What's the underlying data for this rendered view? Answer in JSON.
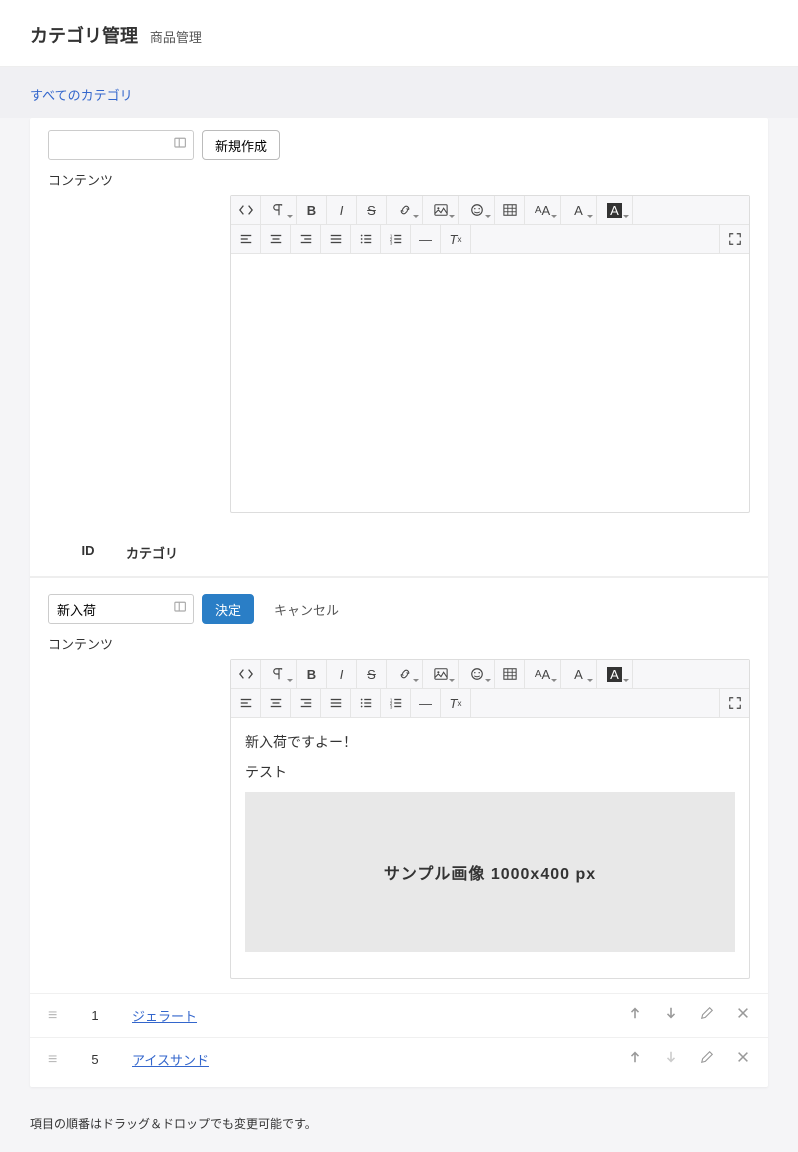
{
  "header": {
    "title": "カテゴリ管理",
    "subtitle": "商品管理"
  },
  "breadcrumb": {
    "all": "すべてのカテゴリ"
  },
  "form": {
    "create_button": "新規作成",
    "content_label": "コンテンツ",
    "confirm_button": "決定",
    "cancel_button": "キャンセル",
    "edit_input_value": "新入荷"
  },
  "table": {
    "col_id": "ID",
    "col_category": "カテゴリ"
  },
  "edit_content": {
    "line1": "新入荷ですよー！",
    "line2": "テスト",
    "sample_label": "サンプル画像 1000x400 px"
  },
  "rows": [
    {
      "id": "1",
      "name": "ジェラート"
    },
    {
      "id": "5",
      "name": "アイスサンド"
    }
  ],
  "footnote": "項目の順番はドラッグ＆ドロップでも変更可能です。"
}
